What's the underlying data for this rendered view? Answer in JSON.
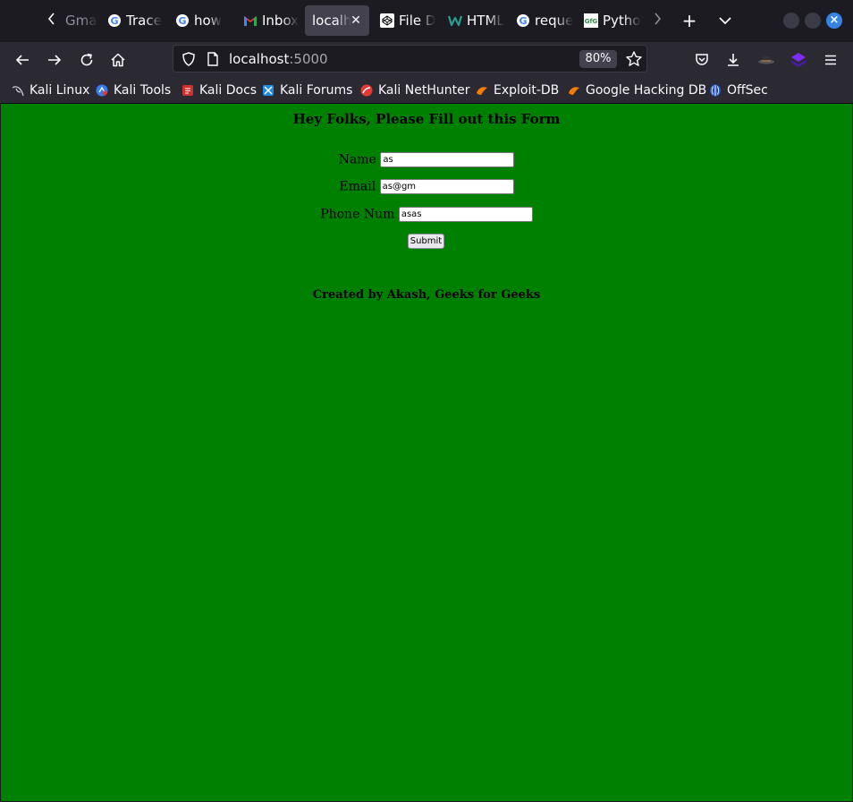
{
  "tabs": [
    {
      "title": "Gmai",
      "icon": "chevron-left-icon"
    },
    {
      "title": "Trace",
      "icon": "google-icon"
    },
    {
      "title": "how",
      "icon": "google-icon"
    },
    {
      "title": "Inbox",
      "icon": "gmail-icon"
    },
    {
      "title": "localhost",
      "icon": "none",
      "active": true
    },
    {
      "title": "File D",
      "icon": "codepen-icon"
    },
    {
      "title": "HTML",
      "icon": "w3-icon"
    },
    {
      "title": "reque",
      "icon": "google-icon"
    },
    {
      "title": "Pytho",
      "icon": "gfg-icon"
    }
  ],
  "nav": {
    "url_host": "localhost",
    "url_port": ":5000",
    "zoom": "80%"
  },
  "bookmarks": [
    {
      "label": "Kali Linux",
      "icon": "kali-icon"
    },
    {
      "label": "Kali Tools",
      "icon": "kali-tools-icon"
    },
    {
      "label": "Kali Docs",
      "icon": "kali-docs-icon"
    },
    {
      "label": "Kali Forums",
      "icon": "kali-forums-icon"
    },
    {
      "label": "Kali NetHunter",
      "icon": "nethunter-icon"
    },
    {
      "label": "Exploit-DB",
      "icon": "exploitdb-icon"
    },
    {
      "label": "Google Hacking DB",
      "icon": "ghdb-icon"
    },
    {
      "label": "OffSec",
      "icon": "offsec-icon"
    }
  ],
  "page": {
    "heading": "Hey Folks, Please Fill out this Form",
    "name_label": "Name",
    "name_value": "as",
    "email_label": "Email",
    "email_value": "as@gm",
    "phone_label": "Phone Num",
    "phone_value": "asas",
    "submit_label": "Submit",
    "footer": "Created by Akash, Geeks for Geeks",
    "background_color": "#008000"
  }
}
